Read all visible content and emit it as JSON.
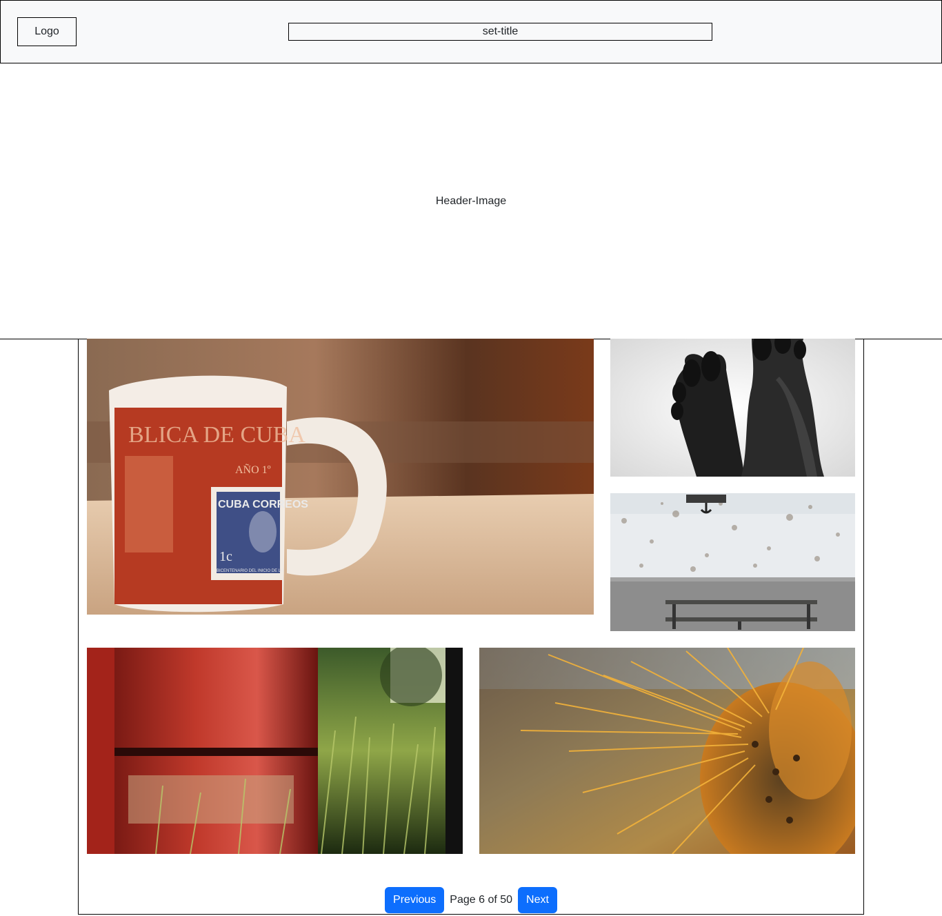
{
  "navbar": {
    "logo": "Logo",
    "title": "set-title"
  },
  "header": {
    "image_label": "Header-Image"
  },
  "gallery": {
    "photos": [
      {
        "name": "mug-photo",
        "stamp_text": "CUBA CORREOS",
        "stamp_value": "1c",
        "stamp_caption": "BICENTENARIO DEL INICIO DE LA",
        "year_text": "AÑO 1º",
        "mug_text": "BLICA DE CUBA"
      },
      {
        "name": "feet-photo"
      },
      {
        "name": "bench-wall-photo"
      },
      {
        "name": "rusty-barrel-grass-photo"
      },
      {
        "name": "cactus-spines-photo"
      }
    ]
  },
  "pagination": {
    "previous": "Previous",
    "status": "Page 6 of 50",
    "next": "Next"
  },
  "colors": {
    "primary": "#0d6efd",
    "navbar_bg": "#f8f9fa"
  }
}
